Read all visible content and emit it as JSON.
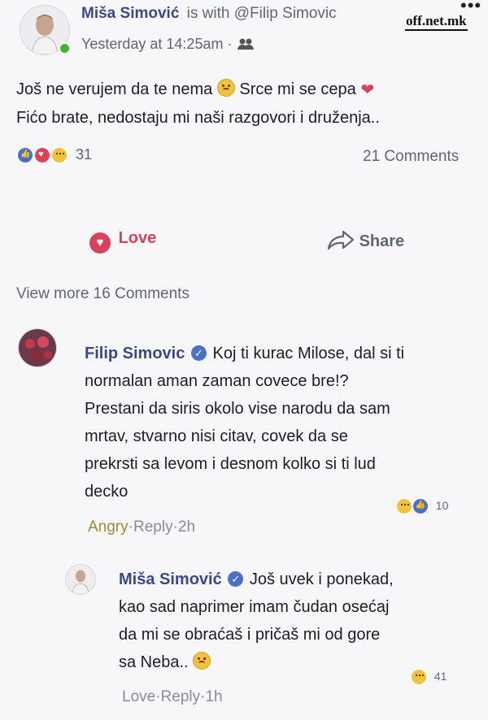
{
  "watermark": "off.net.mk",
  "post": {
    "author": "Miša Simović",
    "with_text": "is with @Filip Simovic",
    "timestamp": "Yesterday at 14:25am",
    "separator": "·",
    "audience_icon": "friends-icon",
    "body_line1_a": "Još ne verujem da te nema",
    "body_line1_b": "Srce mi se cepa",
    "body_line2": "Fićo brate, nedostaju mi naši razgovori i druženja..",
    "reaction_count": "31",
    "comments_count": "21 Comments",
    "love_label": "Love",
    "share_label": "Share",
    "view_more": "View more 16 Comments"
  },
  "comments": [
    {
      "author": "Filip Simovic",
      "text_line1": "Koj ti kurac Milose, dal si ti",
      "text_lines": [
        "normalan aman zaman covece bre!?",
        "Prestani da siris okolo vise narodu da sam",
        "mrtav, stvarno nisi citav, covek da se",
        "prekrsti sa levom i desnom kolko si ti lud",
        "decko"
      ],
      "reaction_count": "10",
      "action_reaction": "Angry",
      "reply_label": "Reply",
      "time": "2h",
      "action_color": "#9a8a3a"
    },
    {
      "author": "Miša Simović",
      "text_line1": "Još uvek i ponekad,",
      "text_lines": [
        "kao sad naprimer imam čudan osećaj",
        "da mi se obraćaš i pričaš mi od gore",
        "sa Neba.."
      ],
      "reaction_count": "41",
      "action_reaction": "Love",
      "reply_label": "Reply",
      "time": "1h"
    }
  ],
  "colors": {
    "name_blue": "#3a4a86",
    "love_red": "#d8425d",
    "verified_blue": "#4a71c6"
  }
}
